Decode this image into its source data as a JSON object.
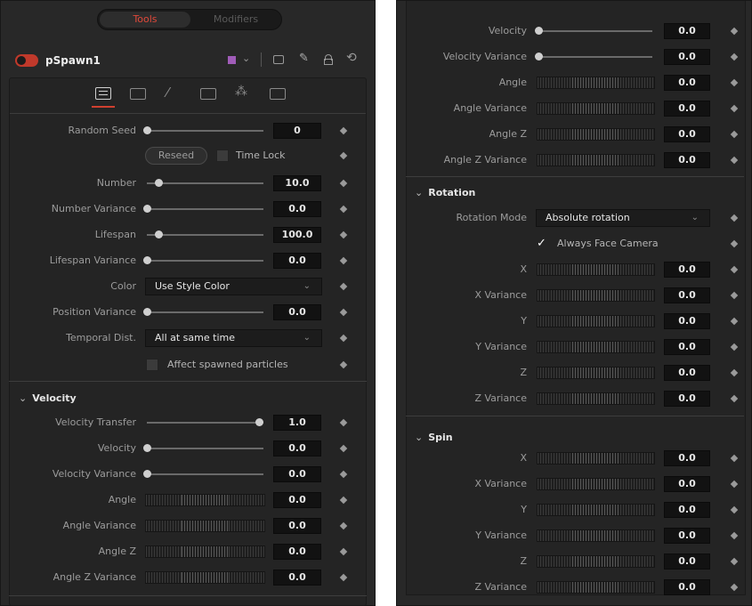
{
  "header": {
    "tabs": [
      {
        "label": "Tools",
        "active": true
      },
      {
        "label": "Modifiers",
        "active": false
      }
    ],
    "node_name": "pSpawn1",
    "accent_color": "#c0392b",
    "swatch_color": "#a05cb8",
    "icons": [
      "dropdown-chevron-icon",
      "version-icon",
      "pin-icon",
      "lock-icon",
      "reset-icon"
    ]
  },
  "left": {
    "inspector_tabs": [
      "controls-icon",
      "style-icon",
      "brush-icon",
      "transform-icon",
      "particles-icon",
      "settings-icon"
    ],
    "random_seed": {
      "label": "Random Seed",
      "value": "0"
    },
    "reseed_label": "Reseed",
    "time_lock_label": "Time Lock",
    "number": {
      "label": "Number",
      "value": "10.0",
      "level": 0.1
    },
    "number_variance": {
      "label": "Number Variance",
      "value": "0.0",
      "level": 0.0
    },
    "lifespan": {
      "label": "Lifespan",
      "value": "100.0",
      "level": 0.1
    },
    "lifespan_variance": {
      "label": "Lifespan Variance",
      "value": "0.0",
      "level": 0.0
    },
    "color": {
      "label": "Color",
      "value": "Use Style Color"
    },
    "position_variance": {
      "label": "Position Variance",
      "value": "0.0",
      "level": 0.0
    },
    "temporal_dist": {
      "label": "Temporal Dist.",
      "value": "All at same time"
    },
    "affect_spawned_label": "Affect spawned particles",
    "velocity_section": "Velocity",
    "velocity_transfer": {
      "label": "Velocity Transfer",
      "value": "1.0",
      "level": 1.0
    },
    "velocity": {
      "label": "Velocity",
      "value": "0.0",
      "level": 0.0
    },
    "velocity_variance": {
      "label": "Velocity Variance",
      "value": "0.0",
      "level": 0.0
    },
    "angle": {
      "label": "Angle",
      "value": "0.0"
    },
    "angle_variance": {
      "label": "Angle Variance",
      "value": "0.0"
    },
    "angle_z": {
      "label": "Angle Z",
      "value": "0.0"
    },
    "angle_z_variance": {
      "label": "Angle Z Variance",
      "value": "0.0"
    }
  },
  "right": {
    "velocity": {
      "label": "Velocity",
      "value": "0.0",
      "level": 0.0
    },
    "velocity_variance": {
      "label": "Velocity Variance",
      "value": "0.0",
      "level": 0.0
    },
    "angle": {
      "label": "Angle",
      "value": "0.0"
    },
    "angle_variance": {
      "label": "Angle Variance",
      "value": "0.0"
    },
    "angle_z": {
      "label": "Angle Z",
      "value": "0.0"
    },
    "angle_z_variance": {
      "label": "Angle Z Variance",
      "value": "0.0"
    },
    "rotation_section": "Rotation",
    "rotation_mode": {
      "label": "Rotation Mode",
      "value": "Absolute rotation"
    },
    "always_face_camera_label": "Always Face Camera",
    "rot_x": {
      "label": "X",
      "value": "0.0"
    },
    "rot_x_variance": {
      "label": "X Variance",
      "value": "0.0"
    },
    "rot_y": {
      "label": "Y",
      "value": "0.0"
    },
    "rot_y_variance": {
      "label": "Y Variance",
      "value": "0.0"
    },
    "rot_z": {
      "label": "Z",
      "value": "0.0"
    },
    "rot_z_variance": {
      "label": "Z Variance",
      "value": "0.0"
    },
    "spin_section": "Spin",
    "spin_x": {
      "label": "X",
      "value": "0.0"
    },
    "spin_x_variance": {
      "label": "X Variance",
      "value": "0.0"
    },
    "spin_y": {
      "label": "Y",
      "value": "0.0"
    },
    "spin_y_variance": {
      "label": "Y Variance",
      "value": "0.0"
    },
    "spin_z": {
      "label": "Z",
      "value": "0.0"
    },
    "spin_z_variance": {
      "label": "Z Variance",
      "value": "0.0"
    }
  }
}
